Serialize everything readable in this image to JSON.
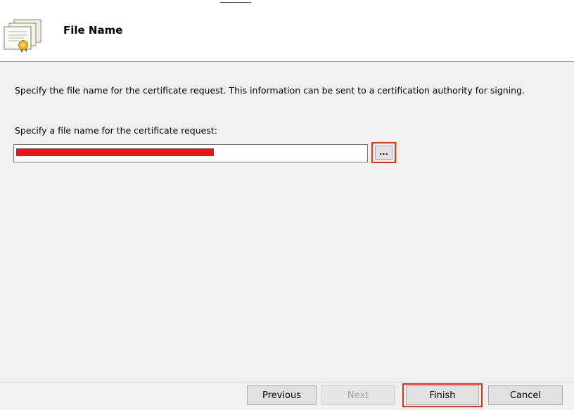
{
  "header": {
    "title": "File Name",
    "icon": "certificate-icon"
  },
  "main": {
    "description": "Specify the file name for the certificate request. This information can be sent to a certification authority for signing.",
    "field_label": "Specify a file name for the certificate request:",
    "file_input": {
      "value": "",
      "redacted": true
    },
    "browse_label": "..."
  },
  "buttons": {
    "previous": "Previous",
    "next": "Next",
    "finish": "Finish",
    "cancel": "Cancel"
  },
  "colors": {
    "highlight": "#e8300e",
    "redaction": "#e8141a",
    "header_background": "#ffffff",
    "body_background": "#f0f0f0",
    "disabled_text": "#a0a0a0"
  }
}
